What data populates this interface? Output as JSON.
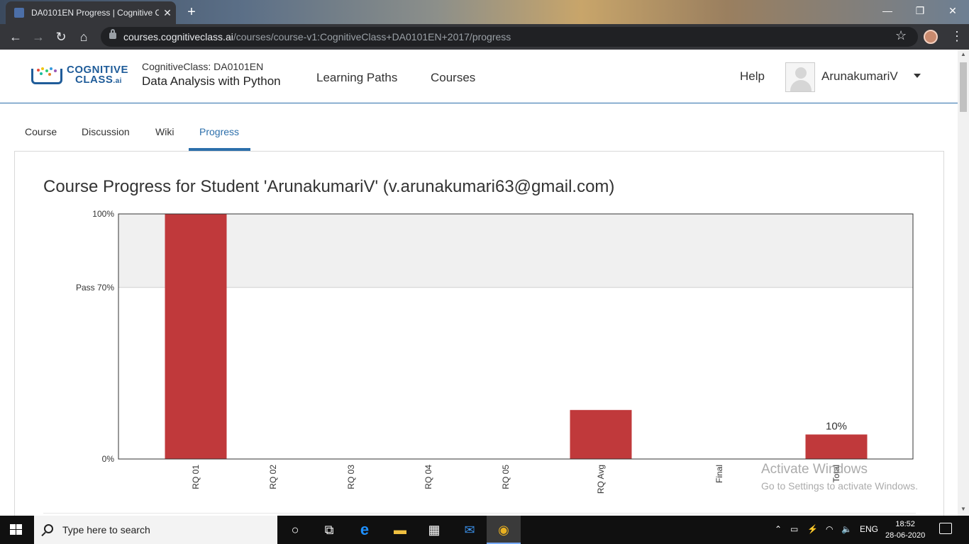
{
  "browser": {
    "tab_title": "DA0101EN Progress | Cognitive C",
    "tab_close": "✕",
    "new_tab": "+",
    "url_host": "courses.cognitiveclass.ai",
    "url_path": "/courses/course-v1:CognitiveClass+DA0101EN+2017/progress",
    "window_controls": {
      "minimize": "—",
      "maximize": "❐",
      "close": "✕"
    }
  },
  "header": {
    "logo_line1": "COGNITIVE",
    "logo_line2": "CLASS",
    "logo_ai": ".ai",
    "course_org": "CognitiveClass: DA0101EN",
    "course_name": "Data Analysis with Python",
    "nav": [
      "Learning Paths",
      "Courses"
    ],
    "help": "Help",
    "username": "ArunakumariV"
  },
  "course_tabs": [
    {
      "label": "Course",
      "active": false
    },
    {
      "label": "Discussion",
      "active": false
    },
    {
      "label": "Wiki",
      "active": false
    },
    {
      "label": "Progress",
      "active": true
    }
  ],
  "progress": {
    "title": "Course Progress for Student 'ArunakumariV' (v.arunakumari63@gmail.com)"
  },
  "chart_data": {
    "type": "bar",
    "categories": [
      "RQ 01",
      "RQ 02",
      "RQ 03",
      "RQ 04",
      "RQ 05",
      "RQ Avg",
      "Final",
      "Total"
    ],
    "values": [
      100,
      0,
      0,
      0,
      0,
      20,
      0,
      10
    ],
    "data_labels": {
      "Total": "10%"
    },
    "y_ticks": [
      {
        "value": 100,
        "label": "100%"
      },
      {
        "value": 70,
        "label": "Pass 70%"
      },
      {
        "value": 0,
        "label": "0%"
      }
    ],
    "ylim": [
      0,
      100
    ],
    "pass_threshold": 70,
    "bar_color": "#c0393b",
    "pass_band_color": "#f0f0f0"
  },
  "watermark": {
    "line1": "Activate Windows",
    "line2": "Go to Settings to activate Windows."
  },
  "taskbar": {
    "search_placeholder": "Type here to search",
    "language": "ENG",
    "time": "18:52",
    "date": "28-06-2020"
  }
}
